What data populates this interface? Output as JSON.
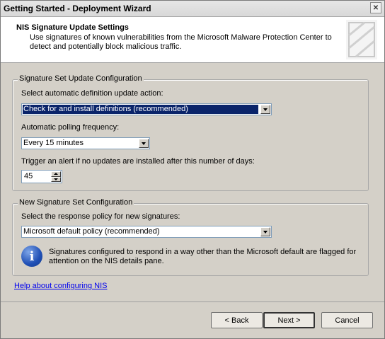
{
  "window": {
    "title": "Getting Started - Deployment Wizard",
    "close_glyph": "✕"
  },
  "header": {
    "title": "NIS Signature Update Settings",
    "description": "Use signatures of known vulnerabilities from the Microsoft Malware Protection Center to detect and potentially block malicious traffic."
  },
  "update_group": {
    "legend": "Signature Set Update Configuration",
    "action_label": "Select automatic definition update action:",
    "action_value": "Check for and install definitions (recommended)",
    "polling_label": "Automatic polling frequency:",
    "polling_value": "Every 15 minutes",
    "alert_label": "Trigger an alert if no updates are installed after this number of days:",
    "alert_days": "45"
  },
  "new_set_group": {
    "legend": "New Signature Set Configuration",
    "policy_label": "Select the response policy for new signatures:",
    "policy_value": "Microsoft default policy (recommended)",
    "info_icon_glyph": "i",
    "info_text": "Signatures configured to respond in a way other than the Microsoft default are flagged for attention on the NIS details pane."
  },
  "help_link": "Help about configuring NIS",
  "buttons": {
    "back": "< Back",
    "next": "Next >",
    "cancel": "Cancel"
  },
  "icons": {
    "close": "close-icon",
    "dropdown": "chevron-down-icon",
    "info": "info-icon",
    "spin_up": "spin-up-icon",
    "spin_down": "spin-down-icon"
  },
  "colors": {
    "selection": "#0a246a",
    "link": "#0000ee",
    "info_icon": "#1f4fb5",
    "dialog_bg": "#d4d0c8"
  }
}
